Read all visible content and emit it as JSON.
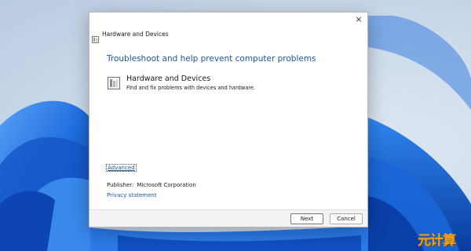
{
  "dialog": {
    "title": "Hardware and Devices",
    "close_glyph": "×",
    "heading": "Troubleshoot and help prevent computer problems",
    "item": {
      "title": "Hardware and Devices",
      "description": "Find and fix problems with devices and hardware.",
      "icon": "troubleshooter-icon"
    },
    "advanced_link": "Advanced",
    "publisher_label": "Publisher:",
    "publisher_value": "Microsoft Corporation",
    "privacy_link": "Privacy statement",
    "buttons": {
      "next": "Next",
      "cancel": "Cancel"
    }
  },
  "watermark": "元计算",
  "colors": {
    "link": "#1e56a0",
    "wallpaper_bloom": "#1f6fe0",
    "watermark": "#f0a41c"
  }
}
